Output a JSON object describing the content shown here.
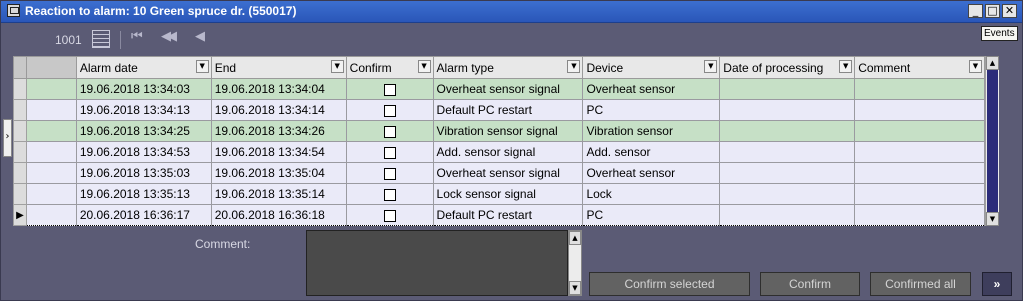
{
  "window": {
    "title": "Reaction to alarm: 10 Green spruce dr. (550017)",
    "minimize_glyph": "_",
    "maximize_glyph": "□",
    "close_glyph": "✕",
    "tooltip": "Events"
  },
  "toolbar": {
    "count": "1001",
    "first_glyph": "⏮",
    "prev_fast_glyph": "◀◀",
    "prev_glyph": "◀"
  },
  "table": {
    "dropdown_glyph": "▼",
    "indicator_glyph": "▶",
    "columns": [
      "Alarm date",
      "End",
      "Confirm",
      "Alarm type",
      "Device",
      "Date of processing",
      "Comment"
    ],
    "rows": [
      {
        "alarm_date": "19.06.2018 13:34:03",
        "end": "19.06.2018 13:34:04",
        "alarm_type": "Overheat sensor signal",
        "device": "Overheat sensor",
        "date_processing": "",
        "comment": "",
        "confirmed": false
      },
      {
        "alarm_date": "19.06.2018 13:34:13",
        "end": "19.06.2018 13:34:14",
        "alarm_type": "Default PC restart",
        "device": "PC",
        "date_processing": "",
        "comment": "",
        "confirmed": false
      },
      {
        "alarm_date": "19.06.2018 13:34:25",
        "end": "19.06.2018 13:34:26",
        "alarm_type": "Vibration sensor signal",
        "device": "Vibration sensor",
        "date_processing": "",
        "comment": "",
        "confirmed": false
      },
      {
        "alarm_date": "19.06.2018 13:34:53",
        "end": "19.06.2018 13:34:54",
        "alarm_type": "Add. sensor signal",
        "device": "Add. sensor",
        "date_processing": "",
        "comment": "",
        "confirmed": false
      },
      {
        "alarm_date": "19.06.2018 13:35:03",
        "end": "19.06.2018 13:35:04",
        "alarm_type": "Overheat sensor signal",
        "device": "Overheat sensor",
        "date_processing": "",
        "comment": "",
        "confirmed": false
      },
      {
        "alarm_date": "19.06.2018 13:35:13",
        "end": "19.06.2018 13:35:14",
        "alarm_type": "Lock sensor signal",
        "device": "Lock",
        "date_processing": "",
        "comment": "",
        "confirmed": false
      },
      {
        "alarm_date": "20.06.2018 16:36:17",
        "end": "20.06.2018 16:36:18",
        "alarm_type": "Default PC restart",
        "device": "PC",
        "date_processing": "",
        "comment": "",
        "confirmed": false
      }
    ]
  },
  "scroll": {
    "up_glyph": "▲",
    "down_glyph": "▼"
  },
  "splitter_glyph": "›",
  "comment": {
    "label": "Comment:",
    "value": ""
  },
  "buttons": {
    "confirm_selected": "Confirm selected",
    "confirm": "Confirm",
    "confirmed_all": "Confirmed all",
    "more": "»"
  },
  "colors": {
    "row_green": "#c6e0c6",
    "row_lavender": "#eaeaf8",
    "titlebar": "#2a56b8",
    "background": "#5b5b75"
  }
}
